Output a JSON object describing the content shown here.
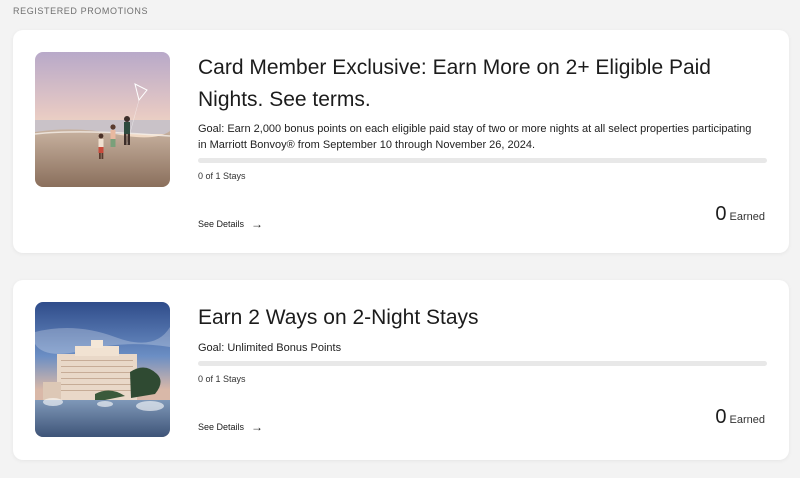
{
  "section": {
    "heading": "REGISTERED PROMOTIONS"
  },
  "promotions": [
    {
      "title": "Card Member Exclusive: Earn More on 2+ Eligible Paid Nights. See terms.",
      "goal": "Goal: Earn 2,000 bonus points on each eligible paid stay of two or more nights at all select properties participating in Marriott Bonvoy® from September 10 through November 26, 2024.",
      "progress_label": "0 of 1 Stays",
      "progress_fraction": 0,
      "details_label": "See Details",
      "earned_value": "0",
      "earned_label": "Earned",
      "image": "beach-family-image"
    },
    {
      "title": "Earn 2 Ways on 2-Night Stays",
      "goal": "Goal: Unlimited Bonus Points",
      "progress_label": "0 of 1 Stays",
      "progress_fraction": 0,
      "details_label": "See Details",
      "earned_value": "0",
      "earned_label": "Earned",
      "image": "bellagio-hotel-image"
    }
  ],
  "icons": {
    "details_arrow": "→"
  }
}
